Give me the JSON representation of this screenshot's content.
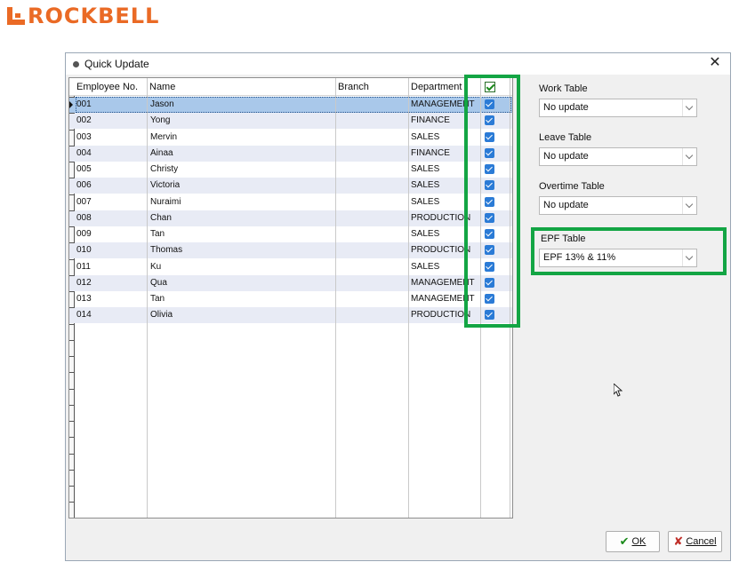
{
  "brand": {
    "name": "ROCKBELL",
    "color": "#ea6a25"
  },
  "dialog": {
    "title": "Quick Update",
    "close_glyph": "✕"
  },
  "grid": {
    "columns": [
      "Employee No.",
      "Name",
      "Branch",
      "Department"
    ],
    "rows": [
      {
        "no": "001",
        "name": "Jason",
        "branch": "",
        "dept": "MANAGEMENT",
        "checked": true,
        "selected": true
      },
      {
        "no": "002",
        "name": "Yong",
        "branch": "",
        "dept": "FINANCE",
        "checked": true
      },
      {
        "no": "003",
        "name": "Mervin",
        "branch": "",
        "dept": "SALES",
        "checked": true
      },
      {
        "no": "004",
        "name": "Ainaa",
        "branch": "",
        "dept": "FINANCE",
        "checked": true
      },
      {
        "no": "005",
        "name": "Christy",
        "branch": "",
        "dept": "SALES",
        "checked": true
      },
      {
        "no": "006",
        "name": "Victoria",
        "branch": "",
        "dept": "SALES",
        "checked": true
      },
      {
        "no": "007",
        "name": "Nuraimi",
        "branch": "",
        "dept": "SALES",
        "checked": true
      },
      {
        "no": "008",
        "name": "Chan",
        "branch": "",
        "dept": "PRODUCTION",
        "checked": true
      },
      {
        "no": "009",
        "name": "Tan",
        "branch": "",
        "dept": "SALES",
        "checked": true
      },
      {
        "no": "010",
        "name": "Thomas",
        "branch": "",
        "dept": "PRODUCTION",
        "checked": true
      },
      {
        "no": "011",
        "name": "Ku",
        "branch": "",
        "dept": "SALES",
        "checked": true
      },
      {
        "no": "012",
        "name": "Qua",
        "branch": "",
        "dept": "MANAGEMENT",
        "checked": true
      },
      {
        "no": "013",
        "name": "Tan",
        "branch": "",
        "dept": "MANAGEMENT",
        "checked": true
      },
      {
        "no": "014",
        "name": "Olivia",
        "branch": "",
        "dept": "PRODUCTION",
        "checked": true
      }
    ],
    "header_checked": true
  },
  "fields": {
    "work_table": {
      "label": "Work Table",
      "value": "No update"
    },
    "leave_table": {
      "label": "Leave Table",
      "value": "No update"
    },
    "overtime_table": {
      "label": "Overtime Table",
      "value": "No update"
    },
    "epf_table": {
      "label": "EPF Table",
      "value": "EPF 13% & 11%"
    }
  },
  "buttons": {
    "ok": {
      "icon": "✔",
      "label": "OK"
    },
    "cancel": {
      "icon": "✘",
      "label": "Cancel"
    }
  },
  "colors": {
    "highlight": "#13a544",
    "checkbox": "#2b7bd6",
    "selected_row": "#a9c8ea",
    "alt_row": "#e8ebf5"
  }
}
